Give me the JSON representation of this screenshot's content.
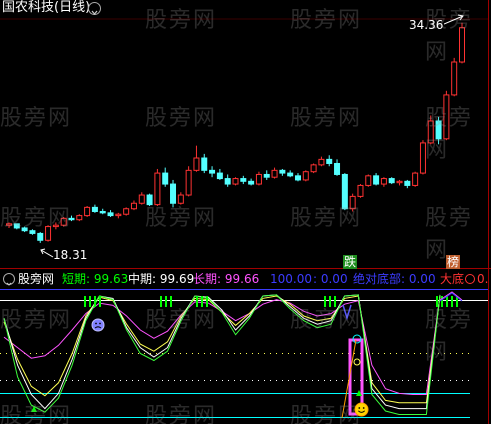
{
  "window": {
    "title": "国农科技(日线)",
    "collapse_icon": "chevron-down-circle-icon"
  },
  "price_panel": {
    "high_label": "34.36",
    "low_label": "18.31",
    "up_color": "#ff3232",
    "down_color": "#54ffff",
    "flat_color": "#ffffff"
  },
  "signals": {
    "fall": "跌",
    "rank": "榜"
  },
  "indicator_panel": {
    "name": "股旁网",
    "short_label": "短期: 99.63",
    "mid_label": "中期: 99.69",
    "long_label": "长期: 99.66",
    "line_100": "100.00",
    "line_0": ": 0.00",
    "abs_bottom": "绝对底部: 0.00",
    "big_bottom": "大底",
    "zero": "0.",
    "colors": {
      "short": "#ffffff",
      "mid": "#ffff54",
      "long": "#ff54ff",
      "abs_bottom": "#5454ff",
      "big_bottom": "#ff3232",
      "bars": "#00ff00",
      "cyan": "#00ffff"
    }
  },
  "watermark": "股旁网",
  "chart_data": {
    "type": "candlestick",
    "price_candles": [
      [
        19.6,
        19.8,
        19.4,
        19.7
      ],
      [
        19.7,
        19.7,
        19.3,
        19.4
      ],
      [
        19.4,
        19.5,
        19.1,
        19.2
      ],
      [
        19.2,
        19.3,
        18.9,
        19.0
      ],
      [
        19.0,
        19.1,
        18.31,
        18.5
      ],
      [
        18.5,
        19.6,
        18.4,
        19.5
      ],
      [
        19.5,
        19.8,
        19.3,
        19.6
      ],
      [
        19.6,
        20.2,
        19.5,
        20.1
      ],
      [
        20.1,
        20.3,
        19.9,
        20.0
      ],
      [
        20.0,
        20.4,
        19.9,
        20.3
      ],
      [
        20.3,
        21.0,
        20.2,
        20.9
      ],
      [
        20.9,
        21.1,
        20.5,
        20.6
      ],
      [
        20.6,
        20.8,
        20.4,
        20.5
      ],
      [
        20.5,
        20.7,
        20.2,
        20.3
      ],
      [
        20.3,
        20.5,
        20.1,
        20.4
      ],
      [
        20.4,
        20.9,
        20.3,
        20.8
      ],
      [
        20.8,
        21.4,
        20.7,
        21.2
      ],
      [
        21.2,
        22.0,
        21.1,
        21.8
      ],
      [
        21.8,
        21.9,
        21.0,
        21.1
      ],
      [
        21.1,
        23.7,
        21.0,
        23.4
      ],
      [
        23.4,
        23.8,
        22.4,
        22.6
      ],
      [
        22.6,
        22.9,
        20.9,
        21.2
      ],
      [
        21.2,
        22.0,
        21.1,
        21.8
      ],
      [
        21.8,
        23.9,
        21.7,
        23.6
      ],
      [
        23.6,
        25.4,
        23.5,
        24.5
      ],
      [
        24.5,
        24.8,
        23.4,
        23.6
      ],
      [
        23.6,
        23.9,
        23.1,
        23.4
      ],
      [
        23.4,
        23.7,
        22.9,
        23.0
      ],
      [
        23.0,
        23.3,
        22.4,
        22.6
      ],
      [
        22.6,
        23.1,
        22.5,
        23.0
      ],
      [
        23.0,
        23.2,
        22.6,
        22.8
      ],
      [
        22.8,
        23.0,
        22.5,
        22.6
      ],
      [
        22.6,
        23.5,
        22.5,
        23.3
      ],
      [
        23.3,
        23.6,
        22.9,
        23.1
      ],
      [
        23.1,
        23.8,
        23.0,
        23.6
      ],
      [
        23.6,
        23.7,
        23.2,
        23.4
      ],
      [
        23.4,
        23.6,
        23.1,
        23.2
      ],
      [
        23.2,
        23.4,
        22.8,
        22.9
      ],
      [
        22.9,
        23.6,
        22.8,
        23.5
      ],
      [
        23.5,
        24.1,
        23.4,
        24.0
      ],
      [
        24.0,
        24.6,
        23.9,
        24.4
      ],
      [
        24.4,
        24.7,
        23.9,
        24.1
      ],
      [
        24.1,
        24.4,
        23.2,
        23.3
      ],
      [
        23.3,
        23.4,
        20.7,
        20.8
      ],
      [
        20.8,
        21.9,
        20.6,
        21.7
      ],
      [
        21.7,
        22.6,
        21.6,
        22.5
      ],
      [
        22.5,
        23.3,
        22.4,
        23.2
      ],
      [
        23.2,
        23.4,
        22.5,
        22.6
      ],
      [
        22.6,
        23.1,
        22.4,
        23.0
      ],
      [
        23.0,
        23.1,
        22.6,
        22.7
      ],
      [
        22.7,
        22.9,
        22.5,
        22.8
      ],
      [
        22.8,
        22.9,
        22.3,
        22.5
      ],
      [
        22.5,
        23.5,
        22.4,
        23.4
      ],
      [
        23.4,
        25.8,
        23.3,
        25.6
      ],
      [
        25.6,
        27.6,
        25.5,
        27.2
      ],
      [
        27.2,
        27.5,
        25.5,
        25.9
      ],
      [
        25.9,
        29.4,
        25.8,
        29.1
      ],
      [
        29.1,
        31.8,
        29.0,
        31.5
      ],
      [
        31.5,
        34.36,
        31.4,
        34.0
      ]
    ],
    "indicator": {
      "short": [
        80,
        40,
        15,
        3,
        16,
        45,
        80,
        99,
        97,
        72,
        55,
        47,
        55,
        80,
        99,
        98,
        87,
        70,
        82,
        99,
        100,
        90,
        80,
        75,
        78,
        99,
        100,
        20,
        6,
        3,
        3,
        3,
        100
      ],
      "mid": [
        77,
        45,
        22,
        14,
        25,
        50,
        82,
        98,
        95,
        75,
        58,
        52,
        60,
        82,
        97,
        96,
        85,
        74,
        84,
        97,
        99,
        92,
        82,
        78,
        80,
        97,
        99,
        25,
        10,
        8,
        8,
        8,
        99
      ],
      "long": [
        64,
        55,
        46,
        48,
        57,
        70,
        84,
        93,
        91,
        82,
        70,
        63,
        69,
        83,
        94,
        93,
        86,
        78,
        84,
        92,
        96,
        93,
        86,
        82,
        84,
        92,
        95,
        40,
        20,
        16,
        15,
        15,
        99
      ]
    },
    "series_names": [
      "短期",
      "中期",
      "长期"
    ],
    "price_range": [
      17.5,
      35.0
    ],
    "indicator_range": [
      -5,
      105
    ]
  }
}
